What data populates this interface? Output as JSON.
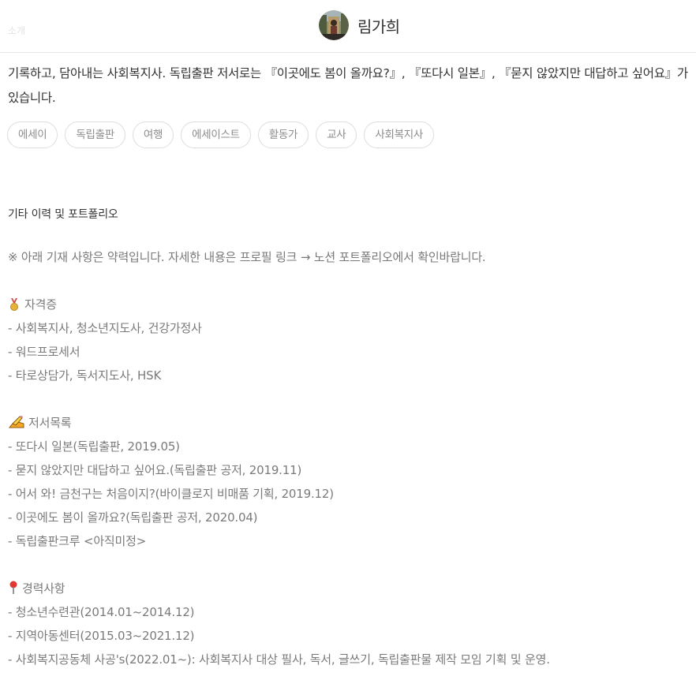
{
  "header": {
    "section_label": "소개",
    "author_name": "림가희"
  },
  "intro": {
    "text": "기록하고, 담아내는 사회복지사. 독립출판 저서로는 『이곳에도 봄이 올까요?』, 『또다시 일본』, 『묻지 않았지만 대답하고 싶어요』가 있습니다."
  },
  "tags": [
    "에세이",
    "독립출판",
    "여행",
    "에세이스트",
    "활동가",
    "교사",
    "사회복지사"
  ],
  "portfolio": {
    "heading": "기타 이력 및 포트폴리오",
    "notice": "※ 아래 기재 사항은 약력입니다. 자세한 내용은 프로필 링크 → 노션 포트폴리오에서 확인바랍니다.",
    "certificates": {
      "icon": "medal-icon",
      "title": "자격증",
      "items": [
        "- 사회복지사, 청소년지도사, 건강가정사",
        "- 워드프로세서",
        "- 타로상담가, 독서지도사, HSK"
      ]
    },
    "books": {
      "icon": "writing-hand-icon",
      "title": "저서목록",
      "items": [
        "- 또다시 일본(독립출판, 2019.05)",
        "- 묻지 않았지만 대답하고 싶어요.(독립출판 공저, 2019.11)",
        "- 어서 와! 금천구는 처음이지?(바이클로지 비매품 기획, 2019.12)",
        "- 이곳에도 봄이 올까요?(독립출판 공저, 2020.04)",
        "- 독립출판크루 <아직미정>"
      ]
    },
    "career": {
      "icon": "pushpin-icon",
      "title": "경력사항",
      "items": [
        "- 청소년수련관(2014.01~2014.12)",
        "- 지역아동센터(2015.03~2021.12)",
        "- 사회복지공동체 사공's(2022.01~): 사회복지사 대상 필사, 독서, 글쓰기, 독립출판물 제작 모임 기획 및 운영."
      ]
    }
  }
}
